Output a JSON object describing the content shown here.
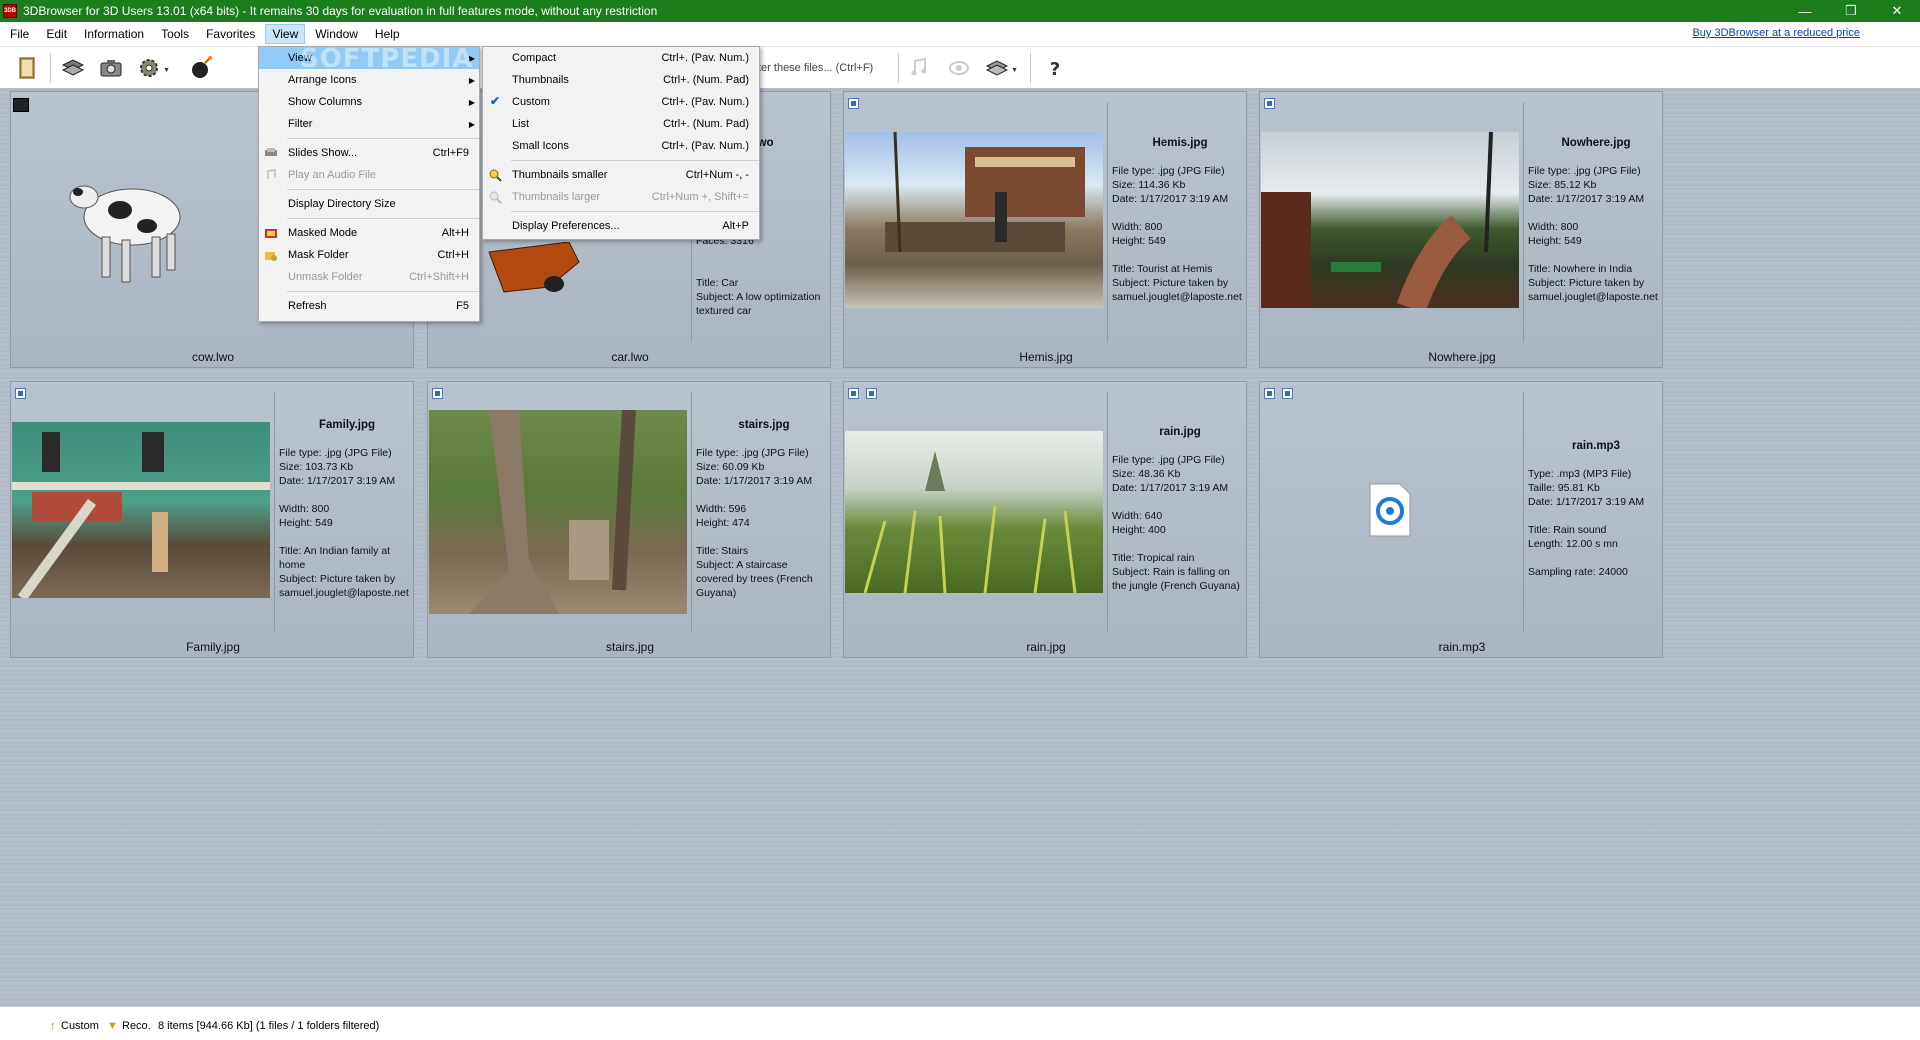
{
  "window": {
    "app_icon_text": "3DB",
    "title": "3DBrowser for 3D Users 13.01 (x64 bits) - It remains 30 days for evaluation in full features mode, without any restriction",
    "minimize": "—",
    "restore": "❐",
    "close": "✕"
  },
  "menubar": {
    "items": [
      "File",
      "Edit",
      "Information",
      "Tools",
      "Favorites",
      "View",
      "Window",
      "Help"
    ],
    "promo_link": "Buy 3DBrowser at a reduced price"
  },
  "toolbar": {
    "filter_text": "ter these files... (Ctrl+F)"
  },
  "view_menu": {
    "items": [
      {
        "label": "View",
        "shortcut": "",
        "submenu": true
      },
      {
        "label": "Arrange Icons",
        "shortcut": "",
        "submenu": true
      },
      {
        "label": "Show Columns",
        "shortcut": "",
        "submenu": true
      },
      {
        "label": "Filter",
        "shortcut": "",
        "submenu": true
      },
      {
        "label": "Slides Show...",
        "shortcut": "Ctrl+F9"
      },
      {
        "label": "Play an Audio File",
        "shortcut": ""
      },
      {
        "label": "Display Directory Size",
        "shortcut": ""
      },
      {
        "label": "Masked Mode",
        "shortcut": "Alt+H"
      },
      {
        "label": "Mask Folder",
        "shortcut": "Ctrl+H"
      },
      {
        "label": "Unmask Folder",
        "shortcut": "Ctrl+Shift+H"
      },
      {
        "label": "Refresh",
        "shortcut": "F5"
      }
    ]
  },
  "view_submenu": {
    "items": [
      {
        "label": "Compact",
        "shortcut": "Ctrl+. (Pav. Num.)"
      },
      {
        "label": "Thumbnails",
        "shortcut": "Ctrl+. (Num. Pad)"
      },
      {
        "label": "Custom",
        "shortcut": "Ctrl+. (Pav. Num.)",
        "checked": true
      },
      {
        "label": "List",
        "shortcut": "Ctrl+. (Num. Pad)"
      },
      {
        "label": "Small Icons",
        "shortcut": "Ctrl+. (Pav. Num.)"
      },
      {
        "label": "Thumbnails smaller",
        "shortcut": "Ctrl+Num -, -"
      },
      {
        "label": "Thumbnails larger",
        "shortcut": "Ctrl+Num +, Shift+="
      },
      {
        "label": "Display Preferences...",
        "shortcut": "Alt+P"
      }
    ]
  },
  "files": [
    {
      "caption": "cow.lwo",
      "lines": []
    },
    {
      "caption": "car.lwo",
      "name": "lwo",
      "lines": [
        "VO File)",
        "Kb",
        "7 3:19 AM"
      ],
      "lines2": [
        "Faces: 3316"
      ],
      "lines3": [
        "Title: Car",
        "Subject: A low optimization",
        "textured car"
      ]
    },
    {
      "caption": "Hemis.jpg",
      "name": "Hemis.jpg",
      "lines": [
        "File type: .jpg (JPG File)",
        "Size: 114.36 Kb",
        "Date: 1/17/2017 3:19 AM"
      ],
      "lines2": [
        "Width: 800",
        "Height: 549"
      ],
      "lines3": [
        "Title: Tourist at Hemis",
        "Subject: Picture taken by",
        "samuel.jouglet@laposte.net"
      ]
    },
    {
      "caption": "Nowhere.jpg",
      "name": "Nowhere.jpg",
      "lines": [
        "File type: .jpg (JPG File)",
        "Size: 85.12 Kb",
        "Date: 1/17/2017 3:19 AM"
      ],
      "lines2": [
        "Width: 800",
        "Height: 549"
      ],
      "lines3": [
        "Title: Nowhere in India",
        "Subject: Picture taken by",
        "samuel.jouglet@laposte.net"
      ]
    },
    {
      "caption": "Family.jpg",
      "name": "Family.jpg",
      "lines": [
        "File type: .jpg (JPG File)",
        "Size: 103.73 Kb",
        "Date: 1/17/2017 3:19 AM"
      ],
      "lines2": [
        "Width: 800",
        "Height: 549"
      ],
      "lines3": [
        "Title: An Indian family at",
        "home",
        "Subject: Picture taken by",
        "samuel.jouglet@laposte.net"
      ]
    },
    {
      "caption": "stairs.jpg",
      "name": "stairs.jpg",
      "lines": [
        "File type: .jpg (JPG File)",
        "Size: 60.09 Kb",
        "Date: 1/17/2017 3:19 AM"
      ],
      "lines2": [
        "Width: 596",
        "Height: 474"
      ],
      "lines3": [
        "Title: Stairs",
        "Subject: A staircase",
        "covered by trees (French",
        "Guyana)"
      ]
    },
    {
      "caption": "rain.jpg",
      "name": "rain.jpg",
      "lines": [
        "File type: .jpg (JPG File)",
        "Size: 48.36 Kb",
        "Date: 1/17/2017 3:19 AM"
      ],
      "lines2": [
        "Width: 640",
        "Height: 400"
      ],
      "lines3": [
        "Title: Tropical rain",
        "Subject: Rain is falling on",
        "the jungle (French Guyana)"
      ]
    },
    {
      "caption": "rain.mp3",
      "name": "rain.mp3",
      "lines": [
        "Type: .mp3 (MP3 File)",
        "Taille: 95.81 Kb",
        "Date: 1/17/2017 3:19 AM"
      ],
      "lines2": [
        "Title: Rain sound",
        "Length: 12.00 s mn"
      ],
      "lines3": [
        "Sampling rate: 24000"
      ]
    }
  ],
  "watermark": "SOFTPEDIA",
  "statusbar": {
    "mode": "Custom",
    "reco": "Reco.",
    "summary": "8 items [944.66 Kb] (1 files / 1 folders filtered)"
  }
}
